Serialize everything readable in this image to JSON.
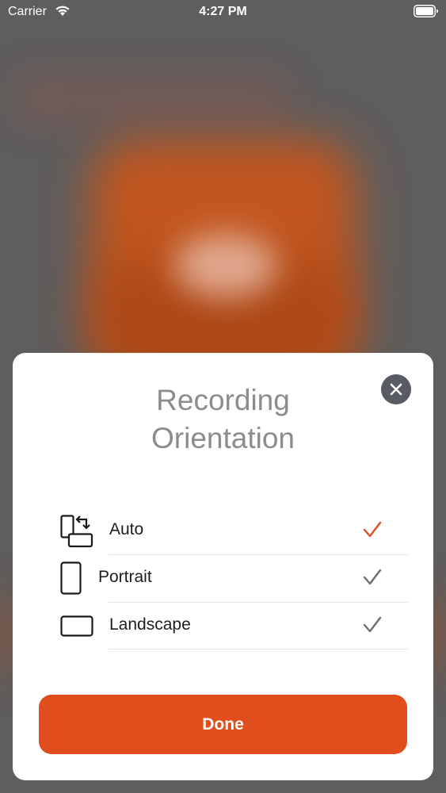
{
  "status_bar": {
    "carrier": "Carrier",
    "time": "4:27 PM"
  },
  "sheet": {
    "title_line1": "Recording",
    "title_line2": "Orientation",
    "close_icon": "close-icon",
    "options": [
      {
        "label": "Auto",
        "icon": "auto-rotate-icon",
        "selected": true
      },
      {
        "label": "Portrait",
        "icon": "portrait-icon",
        "selected": false
      },
      {
        "label": "Landscape",
        "icon": "landscape-icon",
        "selected": false
      }
    ],
    "done_label": "Done"
  },
  "colors": {
    "accent": "#e14e1d",
    "check_selected": "#e14e1d",
    "check_unselected": "#6e6e6e",
    "title": "#8c8c8c"
  }
}
